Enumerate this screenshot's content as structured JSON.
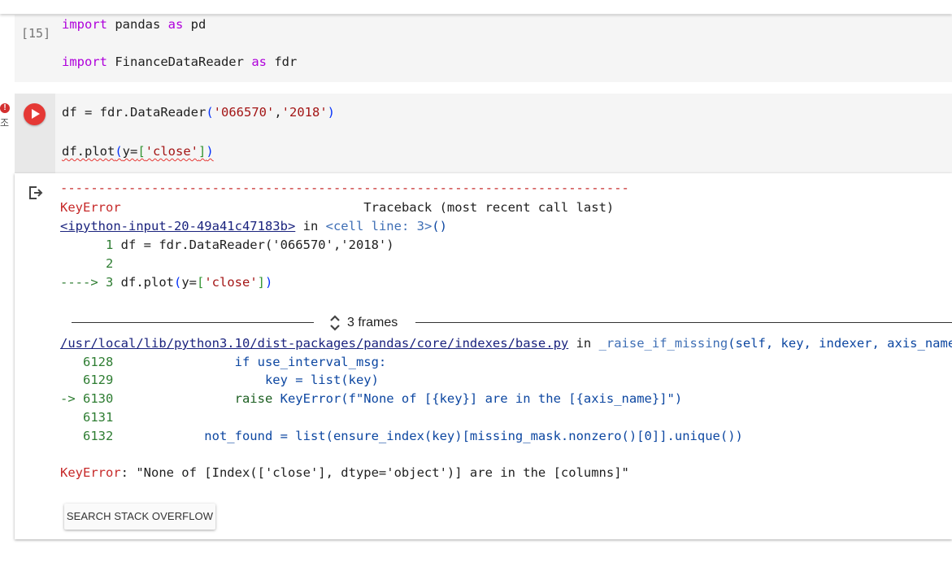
{
  "cell1": {
    "exec_count": "[15]",
    "line1": {
      "kw1": "import",
      "mod": " pandas ",
      "kw2": "as",
      "alias": " pd"
    },
    "line2": {
      "kw1": "import",
      "mod": " FinanceDataReader ",
      "kw2": "as",
      "alias": " fdr"
    }
  },
  "cell2": {
    "side_text": "조",
    "line1": {
      "a": "df = fdr.DataReader",
      "p1": "(",
      "s1": "'066570'",
      "c": ",",
      "s2": "'2018'",
      "p2": ")"
    },
    "line2": {
      "a": "df.plot",
      "p1": "(",
      "b": "y=",
      "p2": "[",
      "s": "'close'",
      "p3": "]",
      "p4": ")"
    }
  },
  "output": {
    "dashes": "---------------------------------------------------------------------------",
    "error_name": "KeyError",
    "traceback_header": "Traceback (most recent call last)",
    "input_link": "<ipython-input-20-49a41c47183b>",
    "in_word": " in ",
    "cell_line": "<cell line: 3>",
    "cell_line_parens": "()",
    "tb_line1": {
      "num": "      1 ",
      "code": "df = fdr.DataReader('066570','2018')"
    },
    "tb_line2": {
      "num": "      2"
    },
    "tb_line3": {
      "arrow": "----> 3 ",
      "a": "df.plot",
      "p1": "(",
      "b": "y=",
      "p2": "[",
      "s": "'close'",
      "p3": "]",
      "p4": ")"
    },
    "frames_label": "3 frames",
    "file_link": "/usr/local/lib/python3.10/dist-packages/pandas/core/indexes/base.py",
    "func_name": "_raise_if_missing",
    "func_args": "(self, key, indexer, axis_name)",
    "src": [
      {
        "num": "   6128 ",
        "code": "               if use_interval_msg:"
      },
      {
        "num": "   6129 ",
        "code": "                   key = list(key)"
      },
      {
        "arrow": "-> 6130 ",
        "kw": "               raise",
        "code": " KeyError(f\"None of [{key}] are in the [{axis_name}]\")"
      },
      {
        "num": "   6131"
      },
      {
        "num": "   6132 ",
        "code": "           not_found = list(ensure_index(key)[missing_mask.nonzero()[0]].unique())"
      }
    ],
    "final_error_name": "KeyError",
    "final_error_msg": ": \"None of [Index(['close'], dtype='object')] are in the [columns]\"",
    "so_button": "SEARCH STACK OVERFLOW"
  }
}
